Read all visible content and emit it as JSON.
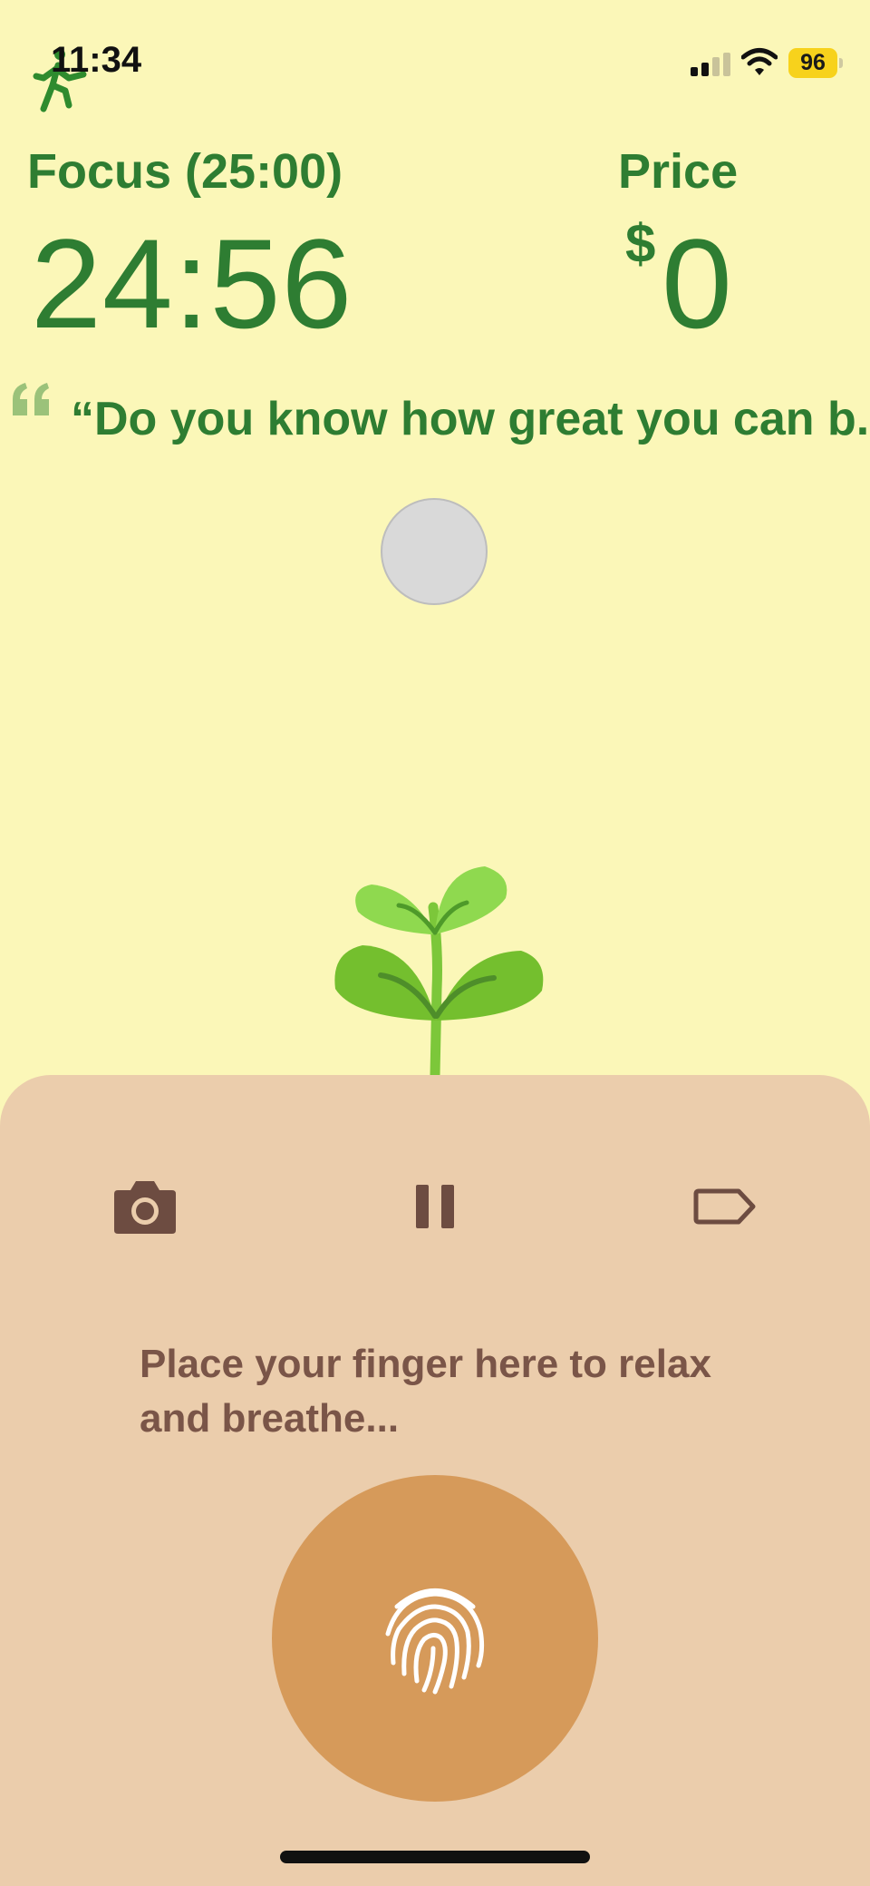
{
  "status_bar": {
    "time": "11:34",
    "battery": "96"
  },
  "header": {
    "focus_label": "Focus (25:00)",
    "timer": "24:56",
    "price_label": "Price",
    "price_currency": "$",
    "price_value": "0"
  },
  "quote": {
    "text": "“Do you know how great you can b..."
  },
  "panel": {
    "breathe_text": "Place your finger here to relax and breathe..."
  },
  "colors": {
    "background": "#FBF7B8",
    "accent_green": "#2E7D32",
    "panel": "#EBCDAC",
    "panel_icon": "#6D4C41",
    "fingerprint_button": "#D69A5A"
  },
  "icons": {
    "runner": "runner-icon",
    "quote": "quote-icon",
    "camera": "camera-icon",
    "pause": "pause-icon",
    "tag": "tag-icon",
    "fingerprint": "fingerprint-icon"
  }
}
